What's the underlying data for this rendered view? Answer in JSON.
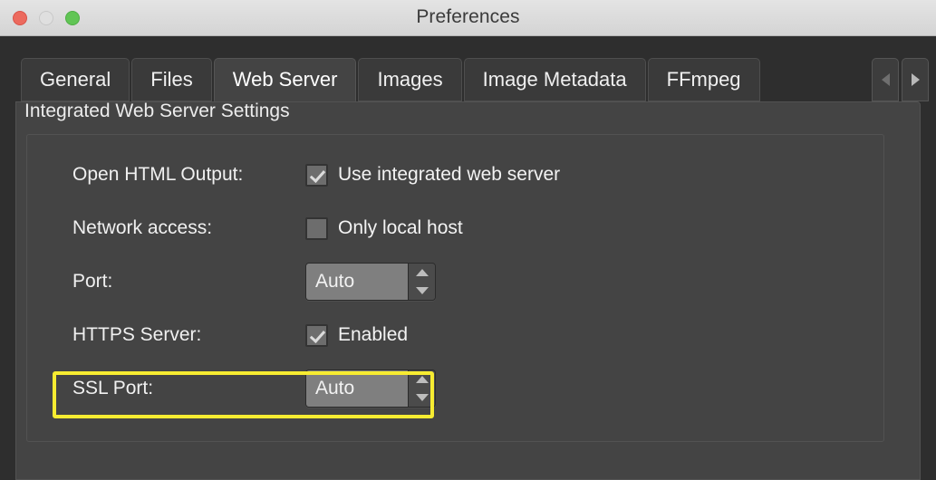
{
  "window": {
    "title": "Preferences",
    "traffic_lights": [
      {
        "name": "close",
        "color": "#ec6a5e"
      },
      {
        "name": "minimize",
        "color": "#dfdfdf"
      },
      {
        "name": "zoom",
        "color": "#61c555"
      }
    ]
  },
  "tabs": {
    "items": [
      {
        "label": "General",
        "active": false
      },
      {
        "label": "Files",
        "active": false
      },
      {
        "label": "Web Server",
        "active": true
      },
      {
        "label": "Images",
        "active": false
      },
      {
        "label": "Image Metadata",
        "active": false
      },
      {
        "label": "FFmpeg",
        "active": false
      }
    ],
    "scroll_left_icon": "triangle-left-icon",
    "scroll_right_icon": "triangle-right-icon"
  },
  "panel": {
    "section_title": "Integrated Web Server Settings",
    "rows": [
      {
        "key": "open_html_output",
        "label": "Open HTML Output:",
        "control": "checkbox",
        "checked": true,
        "text": "Use integrated web server"
      },
      {
        "key": "network_access",
        "label": "Network access:",
        "control": "checkbox",
        "checked": false,
        "text": "Only local host"
      },
      {
        "key": "port",
        "label": "Port:",
        "control": "spinner",
        "value": "Auto"
      },
      {
        "key": "https_server",
        "label": "HTTPS Server:",
        "control": "checkbox",
        "checked": true,
        "text": "Enabled"
      },
      {
        "key": "ssl_port",
        "label": "SSL Port:",
        "control": "spinner",
        "value": "Auto"
      }
    ]
  },
  "annotation": {
    "highlight_color": "#f7ec31",
    "target_row": "https_server"
  }
}
